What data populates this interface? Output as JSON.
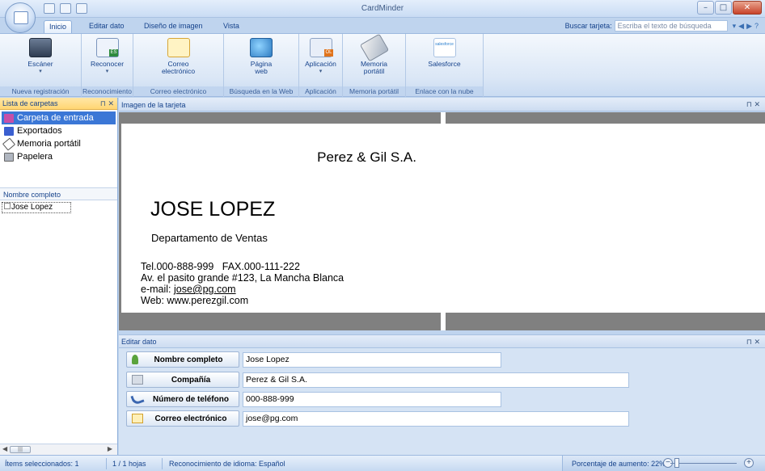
{
  "app": {
    "title": "CardMinder"
  },
  "tabs": [
    {
      "label": "Inicio"
    },
    {
      "label": "Editar dato"
    },
    {
      "label": "Diseño de imagen"
    },
    {
      "label": "Vista"
    }
  ],
  "search": {
    "label": "Buscar tarjeta:",
    "placeholder": "Escriba el texto de búsqueda"
  },
  "ribbon": {
    "groups": [
      {
        "label": "Nueva registración",
        "buttons": [
          {
            "label": "Escáner",
            "icon": "scanner-icon"
          }
        ]
      },
      {
        "label": "Reconocimiento",
        "buttons": [
          {
            "label": "Reconocer",
            "icon": "recognize-icon"
          }
        ]
      },
      {
        "label": "Correo electrónico",
        "buttons": [
          {
            "label": "Correo\nelectrónico",
            "icon": "mail-icon"
          }
        ]
      },
      {
        "label": "Búsqueda en la Web",
        "buttons": [
          {
            "label": "Página\nweb",
            "icon": "web-icon"
          }
        ]
      },
      {
        "label": "Aplicación",
        "buttons": [
          {
            "label": "Aplicación",
            "icon": "outlook-icon"
          }
        ]
      },
      {
        "label": "Memoria portátil",
        "buttons": [
          {
            "label": "Memoria\nportátil",
            "icon": "usb-icon"
          }
        ]
      },
      {
        "label": "Enlace con la nube",
        "buttons": [
          {
            "label": "Salesforce",
            "icon": "salesforce-icon"
          }
        ]
      }
    ]
  },
  "folders": {
    "title": "Lista de carpetas",
    "items": [
      {
        "label": "Carpeta de entrada",
        "icon": "inbox-folder-icon"
      },
      {
        "label": "Exportados",
        "icon": "exported-icon"
      },
      {
        "label": "Memoria portátil",
        "icon": "usb-icon"
      },
      {
        "label": "Papelera",
        "icon": "trash-icon"
      }
    ]
  },
  "namelist": {
    "header": "Nombre completo",
    "rows": [
      {
        "name": "Jose Lopez"
      }
    ]
  },
  "card": {
    "pane_title": "Imagen de la tarjeta",
    "company": "Perez & Gil S.A.",
    "person": "JOSE LOPEZ",
    "department": "Departamento de Ventas",
    "tel_line": "Tel.000-888-999   FAX.000-111-222",
    "address": "Av. el pasito grande #123, La Mancha Blanca",
    "email_prefix": "e-mail: ",
    "email": "jose@pg.com",
    "web": "Web: www.perezgil.com"
  },
  "edit": {
    "pane_title": "Editar dato",
    "fields": [
      {
        "label": "Nombre completo",
        "value": "Jose Lopez",
        "icon": "person-icon"
      },
      {
        "label": "Compañía",
        "value": "Perez & Gil S.A.",
        "icon": "company-icon"
      },
      {
        "label": "Número de teléfono",
        "value": "000-888-999",
        "icon": "phone-icon"
      },
      {
        "label": "Correo electrónico",
        "value": "jose@pg.com",
        "icon": "mail-icon"
      }
    ]
  },
  "status": {
    "selected": "Ítems seleccionados:  1",
    "pages": "1 /  1 hojas",
    "language": "Reconocimiento de idioma: Español",
    "zoom_label": "Porcentaje de aumento:  22%",
    "zoom_percent": 22
  },
  "pane_controls": {
    "pin": "⊓",
    "close": "✕"
  }
}
